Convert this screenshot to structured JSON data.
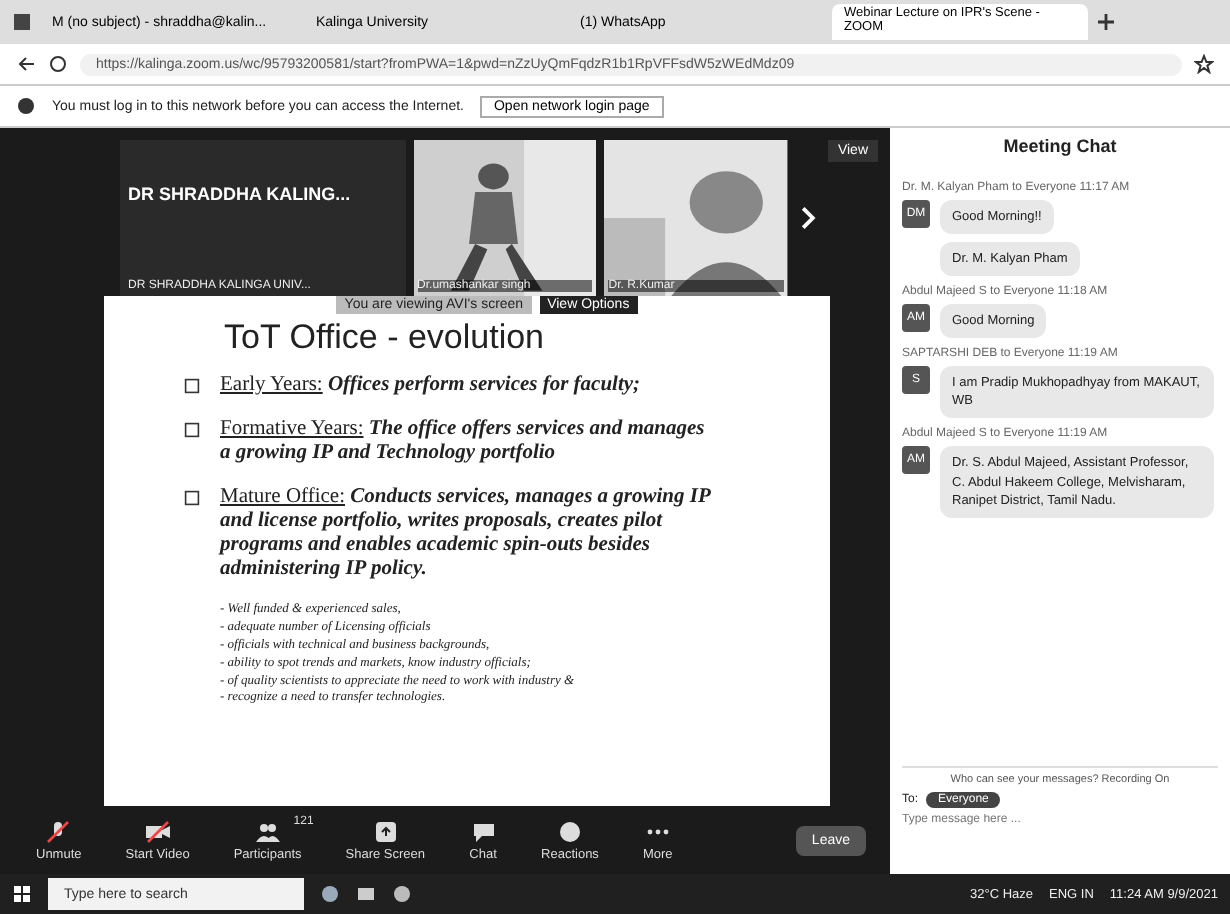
{
  "browser": {
    "tabs": [
      {
        "title": "M (no subject) - shraddha@kalin...",
        "selected": false
      },
      {
        "title": "Kalinga University",
        "selected": false
      },
      {
        "title": "(1) WhatsApp",
        "selected": false
      },
      {
        "title": "Webinar Lecture on IPR's Scene - ZOOM",
        "selected": true
      }
    ],
    "address": "https://kalinga.zoom.us/wc/95793200581/start?fromPWA=1&pwd=nZzUyQmFqdzR1b1RpVFFsdW5zWEdMdz09",
    "notice": "You must log in to this network before you can access the Internet.",
    "notice_button": "Open network login page"
  },
  "meeting": {
    "speaker_name": "DR SHRADDHA KALING...",
    "tiles": [
      {
        "name": "DR SHRADDHA KALINGA UNIV..."
      },
      {
        "name": "Dr.umashankar singh"
      },
      {
        "name": "Dr. R.Kumar"
      }
    ],
    "view_button": "View",
    "banner": "You are viewing AVI's screen",
    "view_options": "View Options",
    "slide": {
      "title": "ToT Office - evolution",
      "points": [
        {
          "lead": "Early Years:",
          "text": "Offices perform services for faculty;"
        },
        {
          "lead": "Formative Years:",
          "text": "The office offers services and manages a growing IP and Technology portfolio"
        },
        {
          "lead": "Mature Office:",
          "text": "Conducts services, manages a growing IP and license portfolio, writes proposals, creates pilot programs and enables academic spin-outs besides administering IP policy."
        }
      ],
      "notes": [
        "- Well funded & experienced sales,",
        "- adequate number of Licensing officials",
        "- officials with technical and business backgrounds,",
        "- ability to spot trends and markets, know industry officials;",
        "- of quality scientists to appreciate the need to work with industry &",
        "- recognize a need to transfer technologies."
      ]
    }
  },
  "toolbar": [
    {
      "label": "Unmute",
      "kind": "mic"
    },
    {
      "label": "Start Video",
      "kind": "video"
    },
    {
      "label": "Participants",
      "kind": "people",
      "count": "121"
    },
    {
      "label": "Share Screen",
      "kind": "share"
    },
    {
      "label": "Chat",
      "kind": "chat"
    },
    {
      "label": "Reactions",
      "kind": "react"
    },
    {
      "label": "More",
      "kind": "more"
    }
  ],
  "leave": "Leave",
  "chat": {
    "title": "Meeting Chat",
    "groups": [
      {
        "sender": "Dr. M. Kalyan Pham to Everyone 11:17 AM",
        "avatar": "DM",
        "messages": [
          "Good Morning!!",
          "Dr. M. Kalyan Pham"
        ]
      },
      {
        "sender": "Abdul Majeed S to Everyone 11:18 AM",
        "avatar": "AM",
        "messages": [
          "Good Morning"
        ]
      },
      {
        "sender": "SAPTARSHI DEB to Everyone 11:19 AM",
        "avatar": "S",
        "messages": [
          "I am Pradip Mukhopadhyay from MAKAUT, WB"
        ]
      },
      {
        "sender": "Abdul Majeed S to Everyone 11:19 AM",
        "avatar": "AM",
        "messages": [
          "Dr. S. Abdul Majeed, Assistant Professor, C. Abdul Hakeem College, Melvisharam, Ranipet District, Tamil Nadu."
        ]
      }
    ],
    "notice": "Who can see your messages? Recording On",
    "to_label": "To:",
    "recipient": "Everyone",
    "placeholder": "Type message here ..."
  },
  "taskbar": {
    "search": "Type here to search",
    "weather": "32°C Haze",
    "lang": "ENG",
    "region": "IN",
    "time": "11:24 AM",
    "date": "9/9/2021"
  }
}
